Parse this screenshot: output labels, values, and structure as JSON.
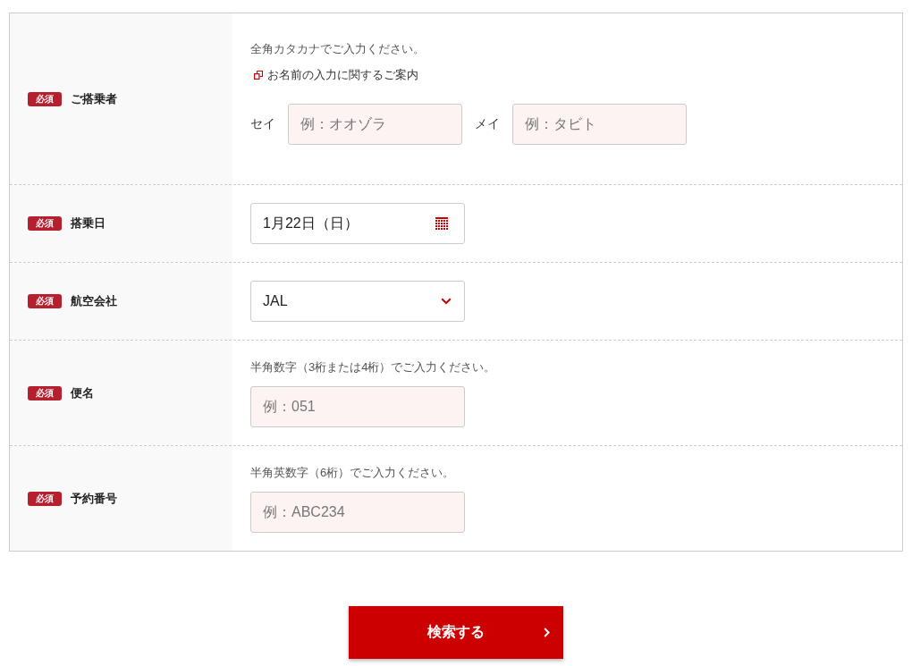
{
  "form": {
    "rows": [
      {
        "kind": "name",
        "required_badge": "必須",
        "label": "ご搭乗者",
        "hint": "全角カタカナでご入力ください。",
        "link": "お名前の入力に関するご案内",
        "fields": [
          {
            "label": "セイ",
            "placeholder": "例：オオゾラ"
          },
          {
            "label": "メイ",
            "placeholder": "例：タビト"
          }
        ]
      },
      {
        "kind": "date",
        "required_badge": "必須",
        "label": "搭乗日",
        "value": "1月22日（日）"
      },
      {
        "kind": "select",
        "required_badge": "必須",
        "label": "航空会社",
        "value": "JAL"
      },
      {
        "kind": "text",
        "required_badge": "必須",
        "label": "便名",
        "hint": "半角数字（3桁または4桁）でご入力ください。",
        "placeholder": "例：051"
      },
      {
        "kind": "text",
        "required_badge": "必須",
        "label": "予約番号",
        "hint": "半角英数字（6桁）でご入力ください。",
        "placeholder": "例：ABC234"
      }
    ]
  },
  "submit_button": {
    "label": "検索する"
  }
}
